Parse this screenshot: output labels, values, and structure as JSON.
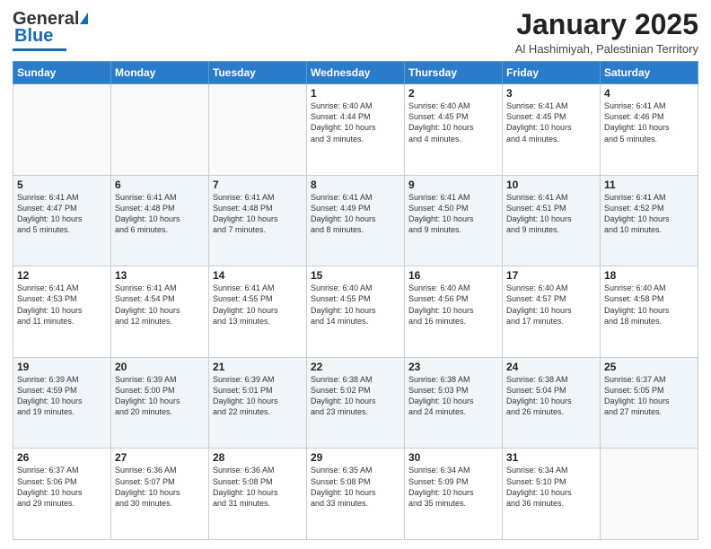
{
  "logo": {
    "general": "General",
    "blue": "Blue"
  },
  "header": {
    "month_title": "January 2025",
    "location": "Al Hashimiyah, Palestinian Territory"
  },
  "days_of_week": [
    "Sunday",
    "Monday",
    "Tuesday",
    "Wednesday",
    "Thursday",
    "Friday",
    "Saturday"
  ],
  "weeks": [
    [
      {
        "day": "",
        "info": ""
      },
      {
        "day": "",
        "info": ""
      },
      {
        "day": "",
        "info": ""
      },
      {
        "day": "1",
        "info": "Sunrise: 6:40 AM\nSunset: 4:44 PM\nDaylight: 10 hours\nand 3 minutes."
      },
      {
        "day": "2",
        "info": "Sunrise: 6:40 AM\nSunset: 4:45 PM\nDaylight: 10 hours\nand 4 minutes."
      },
      {
        "day": "3",
        "info": "Sunrise: 6:41 AM\nSunset: 4:45 PM\nDaylight: 10 hours\nand 4 minutes."
      },
      {
        "day": "4",
        "info": "Sunrise: 6:41 AM\nSunset: 4:46 PM\nDaylight: 10 hours\nand 5 minutes."
      }
    ],
    [
      {
        "day": "5",
        "info": "Sunrise: 6:41 AM\nSunset: 4:47 PM\nDaylight: 10 hours\nand 5 minutes."
      },
      {
        "day": "6",
        "info": "Sunrise: 6:41 AM\nSunset: 4:48 PM\nDaylight: 10 hours\nand 6 minutes."
      },
      {
        "day": "7",
        "info": "Sunrise: 6:41 AM\nSunset: 4:48 PM\nDaylight: 10 hours\nand 7 minutes."
      },
      {
        "day": "8",
        "info": "Sunrise: 6:41 AM\nSunset: 4:49 PM\nDaylight: 10 hours\nand 8 minutes."
      },
      {
        "day": "9",
        "info": "Sunrise: 6:41 AM\nSunset: 4:50 PM\nDaylight: 10 hours\nand 9 minutes."
      },
      {
        "day": "10",
        "info": "Sunrise: 6:41 AM\nSunset: 4:51 PM\nDaylight: 10 hours\nand 9 minutes."
      },
      {
        "day": "11",
        "info": "Sunrise: 6:41 AM\nSunset: 4:52 PM\nDaylight: 10 hours\nand 10 minutes."
      }
    ],
    [
      {
        "day": "12",
        "info": "Sunrise: 6:41 AM\nSunset: 4:53 PM\nDaylight: 10 hours\nand 11 minutes."
      },
      {
        "day": "13",
        "info": "Sunrise: 6:41 AM\nSunset: 4:54 PM\nDaylight: 10 hours\nand 12 minutes."
      },
      {
        "day": "14",
        "info": "Sunrise: 6:41 AM\nSunset: 4:55 PM\nDaylight: 10 hours\nand 13 minutes."
      },
      {
        "day": "15",
        "info": "Sunrise: 6:40 AM\nSunset: 4:55 PM\nDaylight: 10 hours\nand 14 minutes."
      },
      {
        "day": "16",
        "info": "Sunrise: 6:40 AM\nSunset: 4:56 PM\nDaylight: 10 hours\nand 16 minutes."
      },
      {
        "day": "17",
        "info": "Sunrise: 6:40 AM\nSunset: 4:57 PM\nDaylight: 10 hours\nand 17 minutes."
      },
      {
        "day": "18",
        "info": "Sunrise: 6:40 AM\nSunset: 4:58 PM\nDaylight: 10 hours\nand 18 minutes."
      }
    ],
    [
      {
        "day": "19",
        "info": "Sunrise: 6:39 AM\nSunset: 4:59 PM\nDaylight: 10 hours\nand 19 minutes."
      },
      {
        "day": "20",
        "info": "Sunrise: 6:39 AM\nSunset: 5:00 PM\nDaylight: 10 hours\nand 20 minutes."
      },
      {
        "day": "21",
        "info": "Sunrise: 6:39 AM\nSunset: 5:01 PM\nDaylight: 10 hours\nand 22 minutes."
      },
      {
        "day": "22",
        "info": "Sunrise: 6:38 AM\nSunset: 5:02 PM\nDaylight: 10 hours\nand 23 minutes."
      },
      {
        "day": "23",
        "info": "Sunrise: 6:38 AM\nSunset: 5:03 PM\nDaylight: 10 hours\nand 24 minutes."
      },
      {
        "day": "24",
        "info": "Sunrise: 6:38 AM\nSunset: 5:04 PM\nDaylight: 10 hours\nand 26 minutes."
      },
      {
        "day": "25",
        "info": "Sunrise: 6:37 AM\nSunset: 5:05 PM\nDaylight: 10 hours\nand 27 minutes."
      }
    ],
    [
      {
        "day": "26",
        "info": "Sunrise: 6:37 AM\nSunset: 5:06 PM\nDaylight: 10 hours\nand 29 minutes."
      },
      {
        "day": "27",
        "info": "Sunrise: 6:36 AM\nSunset: 5:07 PM\nDaylight: 10 hours\nand 30 minutes."
      },
      {
        "day": "28",
        "info": "Sunrise: 6:36 AM\nSunset: 5:08 PM\nDaylight: 10 hours\nand 31 minutes."
      },
      {
        "day": "29",
        "info": "Sunrise: 6:35 AM\nSunset: 5:08 PM\nDaylight: 10 hours\nand 33 minutes."
      },
      {
        "day": "30",
        "info": "Sunrise: 6:34 AM\nSunset: 5:09 PM\nDaylight: 10 hours\nand 35 minutes."
      },
      {
        "day": "31",
        "info": "Sunrise: 6:34 AM\nSunset: 5:10 PM\nDaylight: 10 hours\nand 36 minutes."
      },
      {
        "day": "",
        "info": ""
      }
    ]
  ]
}
